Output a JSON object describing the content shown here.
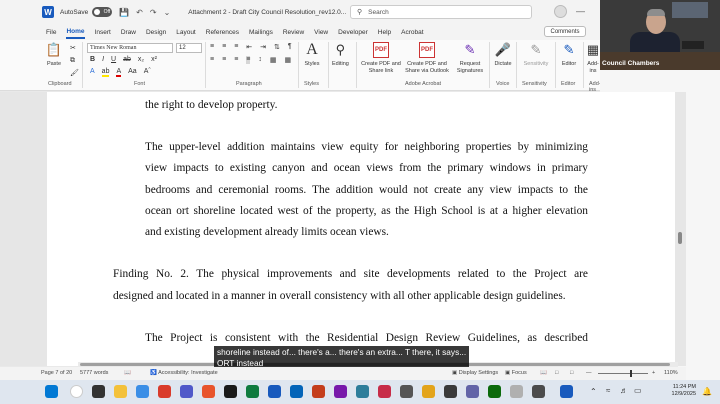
{
  "titlebar": {
    "autosave_label": "AutoSave",
    "autosave_state": "Off",
    "doc_title": "Attachment 2 - Draft City Council Resolution_rev12.0...",
    "search_placeholder": "Search"
  },
  "menu": {
    "tabs": [
      "File",
      "Home",
      "Insert",
      "Draw",
      "Design",
      "Layout",
      "References",
      "Mailings",
      "Review",
      "View",
      "Developer",
      "Help",
      "Acrobat"
    ],
    "active": "Home",
    "comments_label": "Comments"
  },
  "ribbon": {
    "font_name": "Times New Roman",
    "font_size": "12",
    "groups": {
      "clipboard": "Clipboard",
      "font": "Font",
      "paragraph": "Paragraph",
      "styles": "Styles",
      "adobe": "Adobe Acrobat",
      "voice": "Voice",
      "sensitivity": "Sensitivity",
      "editor": "Editor",
      "addins": "Add-ins"
    },
    "buttons": {
      "paste": "Paste",
      "styles": "Styles",
      "editing": "Editing",
      "pdf_share_link": "Create PDF and Share link",
      "pdf_share_outlook": "Create PDF and Share via Outlook",
      "request_signatures": "Request Signatures",
      "dictate": "Dictate",
      "sensitivity": "Sensitivity",
      "editor": "Editor",
      "addins": "Add-ins"
    }
  },
  "document": {
    "lines": [
      {
        "text": "the right to develop property.",
        "last": true,
        "gap": 1
      },
      {
        "text": "The upper-level addition maintains view equity for neighboring properties by minimizing",
        "last": false,
        "gap": 0
      },
      {
        "text": "view impacts to existing canyon and ocean views from the primary windows in primary",
        "last": false,
        "gap": 0
      },
      {
        "text": "bedrooms and ceremonial rooms.  The addition would not create any view impacts to the",
        "last": false,
        "gap": 0
      },
      {
        "text": "ocean ort shoreline located west of the property, as the High School is at a higher elevation",
        "last": false,
        "gap": 0
      },
      {
        "text": "and existing development already limits ocean views.",
        "last": true,
        "gap": 1
      },
      {
        "text": "Finding No. 2. The physical improvements and site developments related to the Project are",
        "last": false,
        "gap": 0,
        "outdent": true
      },
      {
        "text": "designed and located in a manner in overall consistency with all other applicable design guidelines.",
        "last": true,
        "gap": 1,
        "outdent": true
      },
      {
        "text": "The Project is consistent with the Residential Design Review Guidelines, as described",
        "last": false,
        "gap": 0
      }
    ]
  },
  "caption": {
    "line1": "shoreline instead of... there's a... there's an extra... T there, it says...",
    "line2": "ORT instead"
  },
  "statusbar": {
    "page": "Page 7 of 20",
    "words": "5777 words",
    "accessibility": "Accessibility: Investigate",
    "display_settings": "Display Settings",
    "focus": "Focus",
    "zoom": "110%"
  },
  "taskbar": {
    "time": "11:24 PM",
    "date": "12/9/2025"
  },
  "webcam": {
    "label": "Council Chambers"
  }
}
